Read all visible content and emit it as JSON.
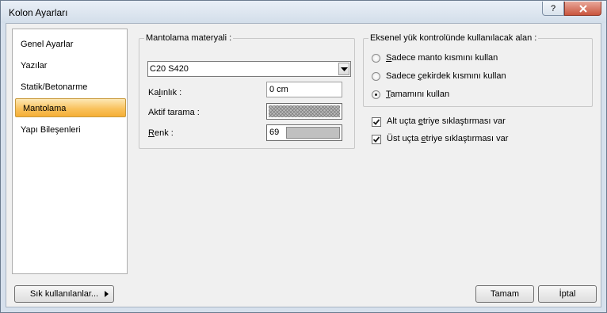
{
  "window": {
    "title": "Kolon Ayarları",
    "help_glyph": "?"
  },
  "sidebar": {
    "items": [
      {
        "label": "Genel Ayarlar"
      },
      {
        "label": "Yazılar"
      },
      {
        "label": "Statik/Betonarme"
      },
      {
        "label": "Mantolama",
        "selected": true
      },
      {
        "label": "Yapı Bileşenleri"
      }
    ]
  },
  "material": {
    "group_label": "Mantolama materyali :",
    "combo_value": "C20 S420",
    "thickness_label_pre": "Ka",
    "thickness_label_ul": "l",
    "thickness_label_post": "ınlık :",
    "thickness_value": "0 cm",
    "hatch_label": "Aktif tarama :",
    "color_label_ul": "R",
    "color_label_post": "enk :",
    "color_value": "69",
    "color_swatch_hex": "#c0c0c0"
  },
  "axial": {
    "group_label": "Eksenel yük kontrolünde kullanılacak alan :",
    "options": [
      {
        "ul": "S",
        "rest": "adece manto kısmını kullan",
        "checked": false
      },
      {
        "pre": "Sadece ",
        "ul": "ç",
        "rest": "ekirdek kısmını kullan",
        "checked": false
      },
      {
        "ul": "T",
        "rest": "amamını kullan",
        "checked": true
      }
    ]
  },
  "checks": [
    {
      "pre": "Alt uçta ",
      "ul": "e",
      "rest": "triye sıklaştırması var",
      "checked": true
    },
    {
      "pre": "Üst uçta ",
      "ul": "e",
      "rest": "triye sıklaştırması var",
      "checked": true
    }
  ],
  "footer": {
    "favorites_label": "Sık kullanılanlar...",
    "ok_label": "Tamam",
    "cancel_label": "İptal"
  },
  "colors": {
    "selection": "#f9c25e",
    "frame": "#d6e0ec",
    "close": "#c9553e"
  }
}
